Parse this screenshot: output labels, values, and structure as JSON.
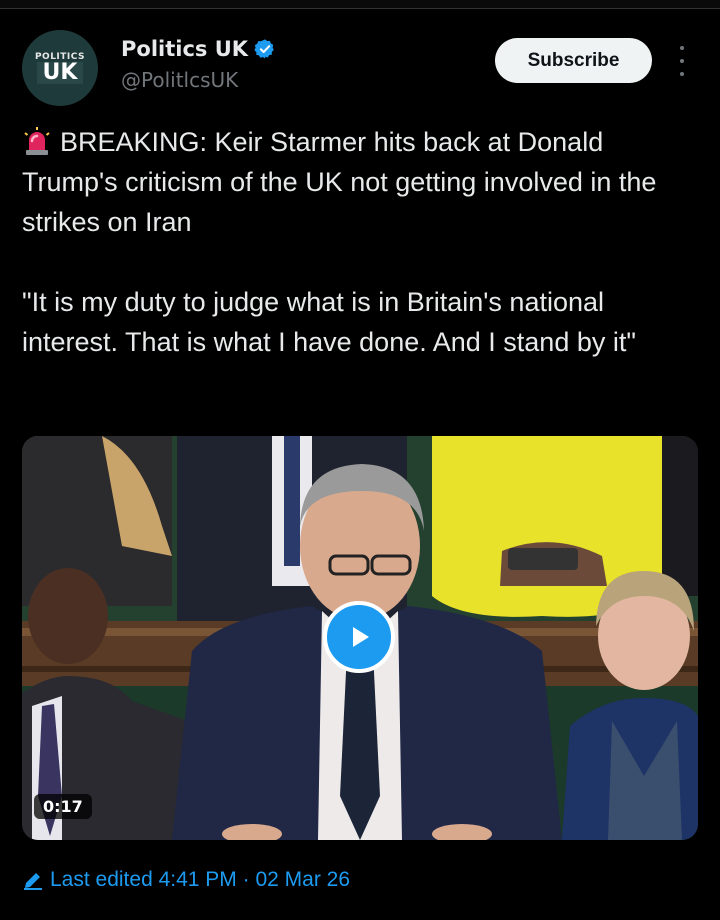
{
  "account": {
    "avatar_small_text": "POLITICS",
    "avatar_big_text": "UK",
    "display_name": "Politics UK",
    "handle": "@PolitlcsUK",
    "verified": true
  },
  "actions": {
    "subscribe_label": "Subscribe",
    "more_icon": "more-vertical-icon"
  },
  "tweet": {
    "emoji": "police-siren-icon",
    "paragraph_1": "BREAKING: Keir Starmer hits back at Donald Trump's criticism of the UK not getting involved in the strikes on Iran",
    "paragraph_2": "\"It is my duty to judge what is in Britain's national interest. That is what I have done. And I stand by it\""
  },
  "media": {
    "type": "video",
    "duration": "0:17",
    "play_icon": "play-icon"
  },
  "footer": {
    "edit_icon": "pencil-icon",
    "edited_label": "Last edited 4:41 PM · 02 Mar 26"
  },
  "colors": {
    "accent": "#1d9bf0",
    "background": "#000000",
    "text": "#e7e9ea",
    "muted": "#71767b"
  }
}
